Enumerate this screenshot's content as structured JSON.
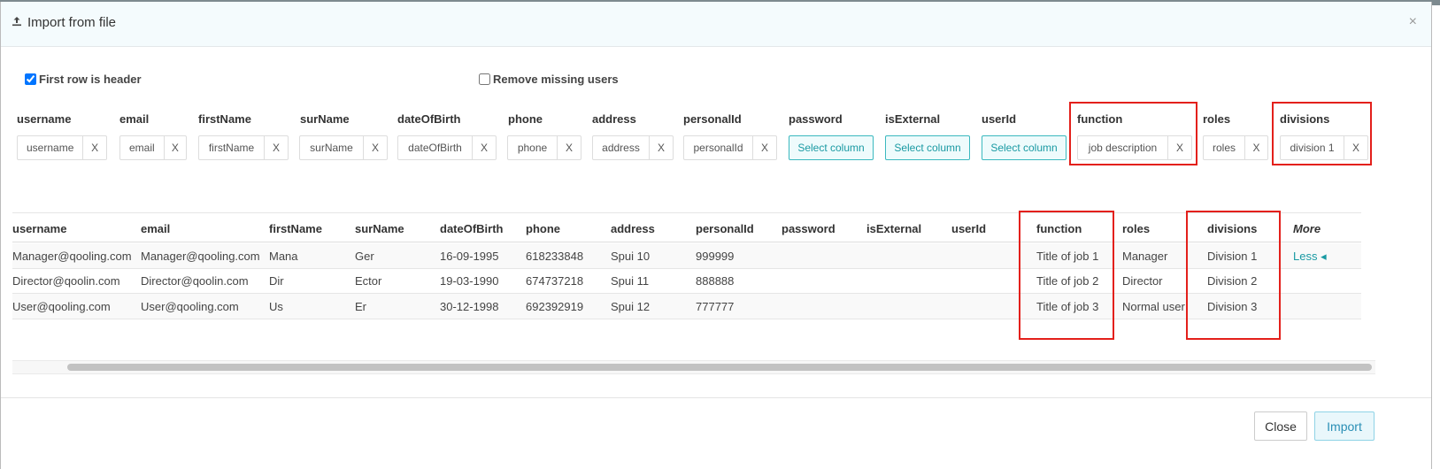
{
  "modal": {
    "title": "Import from file",
    "close_symbol": "×",
    "title_icon": "upload-icon"
  },
  "options": {
    "first_row_header": {
      "label": "First row is header",
      "checked": true
    },
    "remove_missing_users": {
      "label": "Remove missing users",
      "checked": false
    }
  },
  "mapping": {
    "headers": [
      "username",
      "email",
      "firstName",
      "surName",
      "dateOfBirth",
      "phone",
      "address",
      "personalId",
      "password",
      "isExternal",
      "userId",
      "function",
      "roles",
      "divisions"
    ],
    "fields": [
      {
        "type": "chip",
        "value": "username",
        "remove": "X"
      },
      {
        "type": "chip",
        "value": "email",
        "remove": "X"
      },
      {
        "type": "chip",
        "value": "firstName",
        "remove": "X"
      },
      {
        "type": "chip",
        "value": "surName",
        "remove": "X"
      },
      {
        "type": "chip",
        "value": "dateOfBirth",
        "remove": "X"
      },
      {
        "type": "chip",
        "value": "phone",
        "remove": "X"
      },
      {
        "type": "chip",
        "value": "address",
        "remove": "X"
      },
      {
        "type": "chip",
        "value": "personalId",
        "remove": "X"
      },
      {
        "type": "select",
        "value": "Select column"
      },
      {
        "type": "select",
        "value": "Select column"
      },
      {
        "type": "select",
        "value": "Select column"
      },
      {
        "type": "chip",
        "value": "job description",
        "remove": "X"
      },
      {
        "type": "chip",
        "value": "roles",
        "remove": "X"
      },
      {
        "type": "chip",
        "value": "division 1",
        "remove": "X"
      }
    ]
  },
  "table": {
    "columns": [
      "username",
      "email",
      "firstName",
      "surName",
      "dateOfBirth",
      "phone",
      "address",
      "personalId",
      "password",
      "isExternal",
      "userId",
      "function",
      "roles",
      "divisions",
      "More"
    ],
    "rows": [
      [
        "Manager@qooling.com",
        "Manager@qooling.com",
        "Mana",
        "Ger",
        "16-09-1995",
        "618233848",
        "Spui 10",
        "999999",
        "",
        "",
        "",
        "Title of job 1",
        "Manager",
        "Division 1",
        "Less ◂"
      ],
      [
        "Director@qoolin.com",
        "Director@qoolin.com",
        "Dir",
        "Ector",
        "19-03-1990",
        "674737218",
        "Spui 11",
        "888888",
        "",
        "",
        "",
        "Title of job 2",
        "Director",
        "Division 2",
        ""
      ],
      [
        "User@qooling.com",
        "User@qooling.com",
        "Us",
        "Er",
        "30-12-1998",
        "692392919",
        "Spui 12",
        "777777",
        "",
        "",
        "",
        "Title of job 3",
        "Normal user",
        "Division 3",
        ""
      ]
    ]
  },
  "footer": {
    "close_label": "Close",
    "import_label": "Import"
  },
  "colors": {
    "accent": "#1a9aa3",
    "highlight": "#e3201b",
    "header_bg": "#f4fbfd"
  }
}
